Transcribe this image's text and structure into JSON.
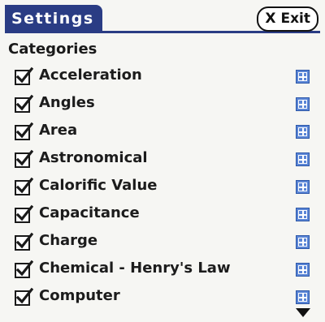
{
  "title": "Settings",
  "exit_button": {
    "icon": "X",
    "label": "Exit"
  },
  "section_label": "Categories",
  "categories": [
    {
      "label": "Acceleration",
      "checked": true
    },
    {
      "label": "Angles",
      "checked": true
    },
    {
      "label": "Area",
      "checked": true
    },
    {
      "label": "Astronomical",
      "checked": true
    },
    {
      "label": "Calorific Value",
      "checked": true
    },
    {
      "label": "Capacitance",
      "checked": true
    },
    {
      "label": "Charge",
      "checked": true
    },
    {
      "label": "Chemical - Henry's Law",
      "checked": true
    },
    {
      "label": "Computer",
      "checked": true
    }
  ],
  "icons": {
    "checkbox": "checkbox-checked-icon",
    "expand": "plus-square-icon",
    "scroll": "arrow-down-icon"
  },
  "colors": {
    "title_bar": "#2a3c84",
    "expand_button": "#5b86d6",
    "text": "#1c1c1c"
  }
}
